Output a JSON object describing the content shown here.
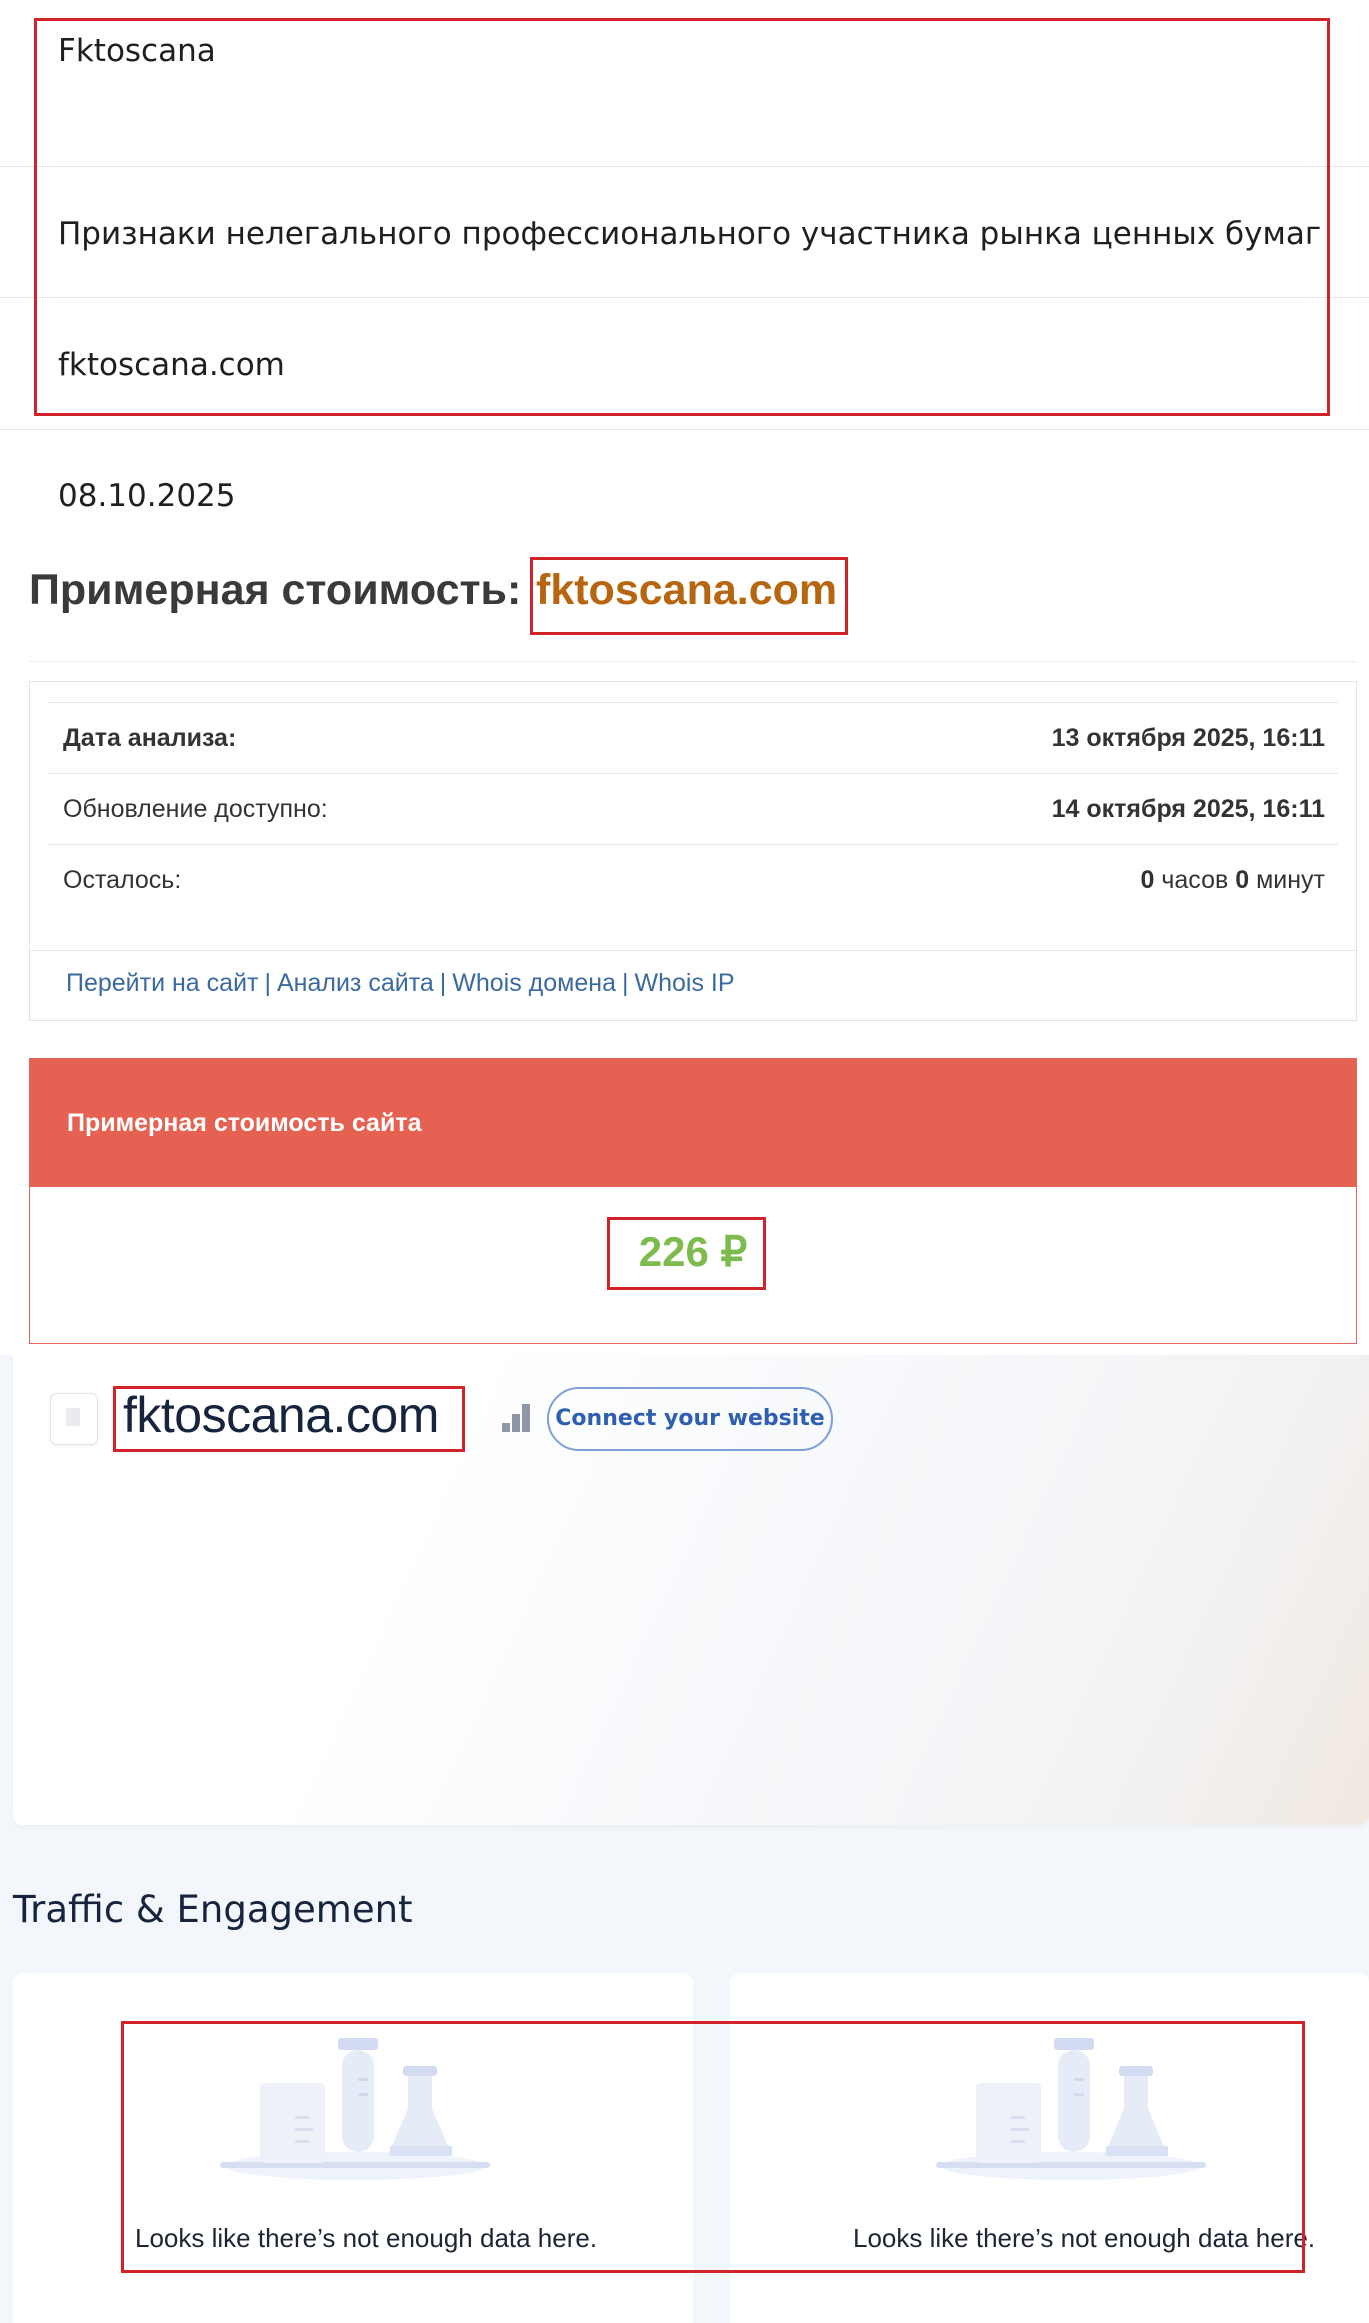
{
  "info": {
    "name": "Fktoscana",
    "warning": "Признаки нелегального профессионального участника рынка ценных бумаг",
    "domain": "fktoscana.com",
    "date": "08.10.2025"
  },
  "cost_section": {
    "heading": "Примерная стоимость:",
    "domain": "fktoscana.com",
    "rows": [
      {
        "label": "Дата анализа:",
        "value": "13 октября 2025, 16:11"
      },
      {
        "label": "Обновление доступно:",
        "value": "14 октября 2025, 16:11"
      },
      {
        "label": "Осталось:",
        "hours": "0",
        "hours_unit": "часов",
        "minutes": "0",
        "minutes_unit": "минут"
      }
    ],
    "links": [
      "Перейти на сайт",
      "Анализ сайта",
      "Whois домена",
      "Whois IP"
    ],
    "separator": "|"
  },
  "value_panel": {
    "title": "Примерная стоимость сайта",
    "price": "226 ₽"
  },
  "site_header": {
    "domain": "fktoscana.com",
    "connect_label": "Connect your website"
  },
  "traffic": {
    "title": "Traffic & Engagement",
    "panels": [
      {
        "empty_message": "Looks like there’s not enough data here."
      },
      {
        "empty_message": "Looks like there’s not enough data here."
      }
    ]
  },
  "colors": {
    "highlight_border": "#d2232a",
    "domain_orange": "#b8650f",
    "panel_red": "#e56253",
    "price_green": "#7dbb4e",
    "link_blue": "#3b6aa0"
  }
}
